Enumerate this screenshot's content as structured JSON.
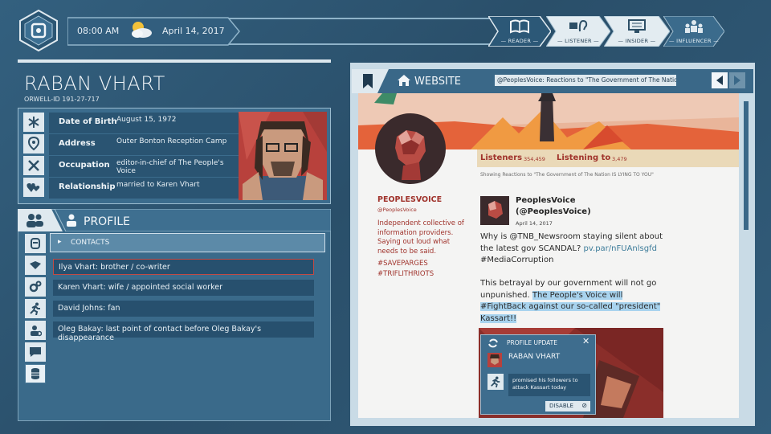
{
  "topbar": {
    "time": "08:00 AM",
    "date": "April 14, 2017",
    "levels": [
      {
        "label": "— READER —",
        "icon": "book-icon",
        "active": true
      },
      {
        "label": "— LISTENER —",
        "icon": "ear-icon",
        "active": false
      },
      {
        "label": "— INSIDER —",
        "icon": "monitor-icon",
        "active": false
      },
      {
        "label": "— INFLUENCER —",
        "icon": "people-icon",
        "active": false
      }
    ]
  },
  "profile": {
    "name": "RABAN VHART",
    "orwell_id": "ORWELL-ID  191-27-717",
    "info": [
      {
        "key": "Date of Birth",
        "value": "August 15, 1972",
        "icon": "asterisk-icon"
      },
      {
        "key": "Address",
        "value": "Outer Bonton Reception Camp",
        "icon": "location-icon"
      },
      {
        "key": "Occupation",
        "value": "editor-in-chief of The People's Voice",
        "icon": "tools-icon"
      },
      {
        "key": "Relationship",
        "value": "married to Karen Vhart",
        "icon": "hearts-icon"
      }
    ],
    "section_title": "PROFILE",
    "contacts_label": "CONTACTS",
    "contacts": [
      "Ilya Vhart: brother / co-writer",
      "Karen Vhart: wife / appointed social worker",
      "David Johns: fan",
      "Oleg Bakay: last point of contact before Oleg Bakay's disappearance"
    ]
  },
  "website": {
    "tab_label": "WEBSITE",
    "url": "@PeoplesVoice: Reactions to \"The Government of The Nation IS...",
    "account_name": "PEOPLESVOICE",
    "account_handle": "@PeoplesVoice",
    "bio": "Independent collective of information providers. Saying out loud what needs to be said.",
    "hashtags": [
      "#SAVEPARGES",
      "#TRIFLITHRIOTS"
    ],
    "listeners_label": "Listeners",
    "listeners_count": "354,459",
    "listening_label": "Listening to",
    "listening_count": "3,479",
    "showing": "Showing Reactions to \"The Government of The Nation IS LYING TO YOU\"",
    "post": {
      "author": "PeoplesVoice",
      "handle": "(@PeoplesVoice)",
      "date": "April 14, 2017",
      "text1": "Why is @TNB_Newsroom staying silent about the latest gov SCANDAL?",
      "link": "pv.par/nFUAnlsgfd",
      "tag": "#MediaCorruption",
      "text2": "This betrayal by our government will not go unpunished.",
      "highlight1": "The People's Voice will",
      "highlight2": "#FightBack against our so-called \"president\"",
      "highlight3": "Kassart!!"
    }
  },
  "popup": {
    "title": "PROFILE UPDATE",
    "name": "RABAN VHART",
    "message": "promised his followers to attack Kassart today",
    "disable_label": "DISABLE"
  },
  "colors": {
    "accent": "#3a6888",
    "highlight": "#a8d3ee",
    "site_red": "#a0332c"
  }
}
